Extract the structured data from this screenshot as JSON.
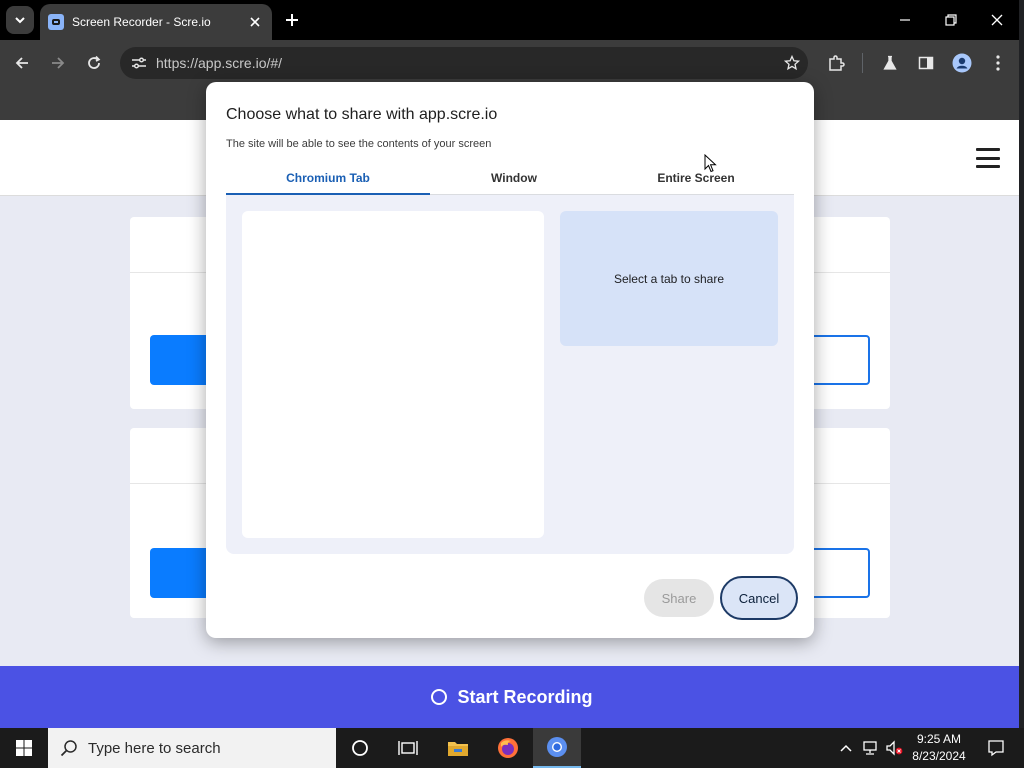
{
  "browser": {
    "tab_title": "Screen Recorder - Scre.io",
    "url": "https://app.scre.io/#/"
  },
  "dialog": {
    "title": "Choose what to share with app.scre.io",
    "subtitle": "The site will be able to see the contents of your screen",
    "tabs": [
      {
        "label": "Chromium Tab",
        "active": true
      },
      {
        "label": "Window",
        "active": false
      },
      {
        "label": "Entire Screen",
        "active": false
      }
    ],
    "preview_text": "Select a tab to share",
    "share_label": "Share",
    "cancel_label": "Cancel"
  },
  "page": {
    "record_label": "Start Recording"
  },
  "taskbar": {
    "search_placeholder": "Type here to search",
    "time": "9:25 AM",
    "date": "8/23/2024"
  },
  "colors": {
    "record_bar": "#4b52e4",
    "page_button": "#0a7cff",
    "active_tab": "#1a5fb4",
    "preview_bg": "#d6e2f8"
  }
}
